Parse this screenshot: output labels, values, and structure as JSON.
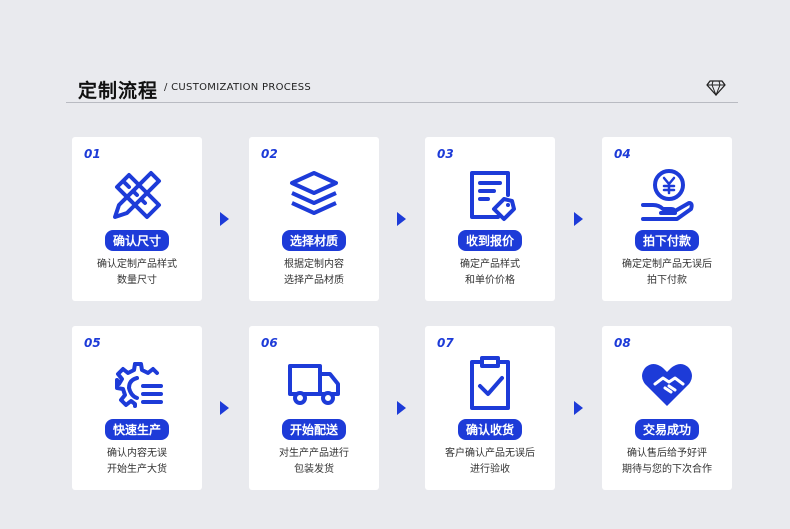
{
  "header": {
    "title_cn": "定制流程",
    "title_en": "/ CUSTOMIZATION PROCESS",
    "diamond_icon": "diamond-icon"
  },
  "accent_color": "#1d3bd8",
  "steps": [
    {
      "num": "01",
      "badge": "确认尺寸",
      "line1": "确认定制产品样式",
      "line2": "数量尺寸",
      "icon": "ruler-pencil-icon"
    },
    {
      "num": "02",
      "badge": "选择材质",
      "line1": "根据定制内容",
      "line2": "选择产品材质",
      "icon": "layers-icon"
    },
    {
      "num": "03",
      "badge": "收到报价",
      "line1": "确定产品样式",
      "line2": "和单价价格",
      "icon": "quote-document-icon"
    },
    {
      "num": "04",
      "badge": "拍下付款",
      "line1": "确定定制产品无误后",
      "line2": "拍下付款",
      "icon": "yen-coin-hand-icon"
    },
    {
      "num": "05",
      "badge": "快速生产",
      "line1": "确认内容无误",
      "line2": "开始生产大货",
      "icon": "gear-production-icon"
    },
    {
      "num": "06",
      "badge": "开始配送",
      "line1": "对生产产品进行",
      "line2": "包装发货",
      "icon": "truck-icon"
    },
    {
      "num": "07",
      "badge": "确认收货",
      "line1": "客户确认产品无误后",
      "line2": "进行验收",
      "icon": "clipboard-check-icon"
    },
    {
      "num": "08",
      "badge": "交易成功",
      "line1": "确认售后给予好评",
      "line2": "期待与您的下次合作",
      "icon": "heart-handshake-icon"
    }
  ]
}
